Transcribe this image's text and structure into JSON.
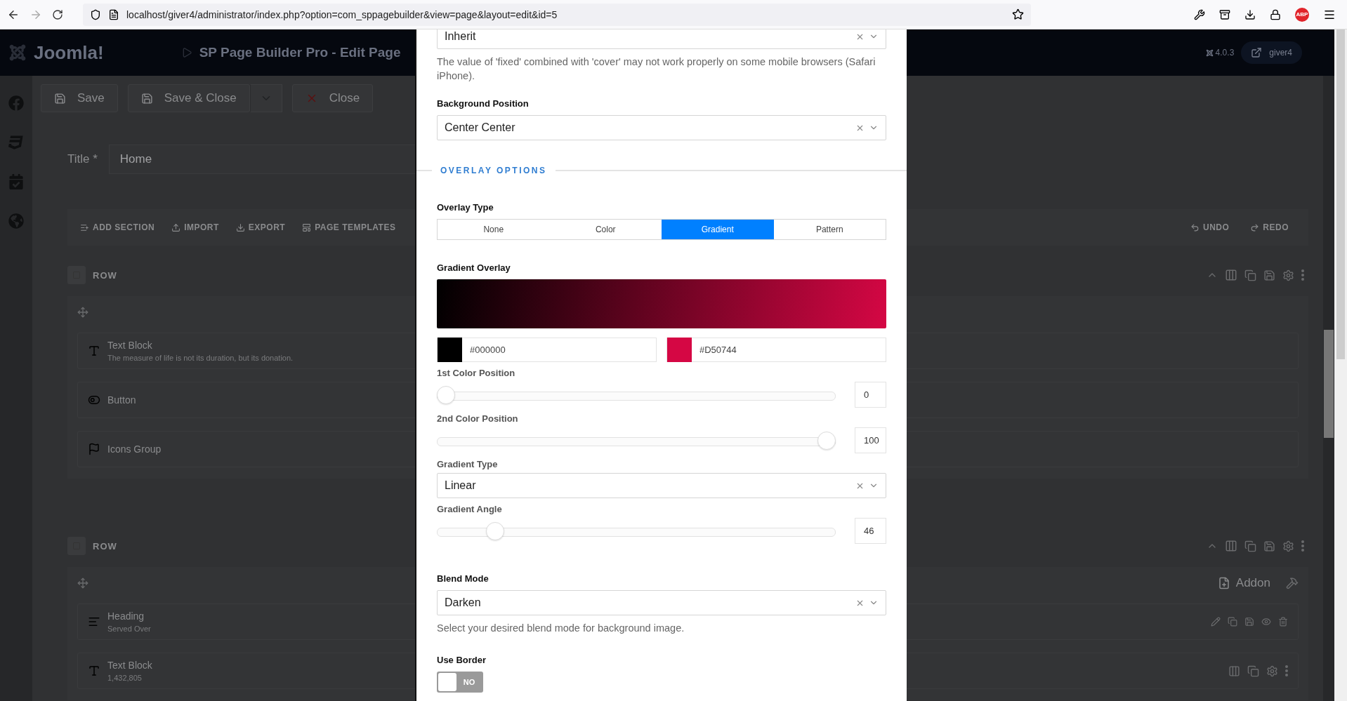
{
  "browser": {
    "url": "localhost/giver4/administrator/index.php?option=com_sppagebuilder&view=page&layout=edit&id=5",
    "extension_badge": "ABP"
  },
  "header": {
    "logo": "Joomla!",
    "title": "SP Page Builder Pro - Edit Page",
    "version": "4.0.3",
    "user": "giver4"
  },
  "toolbar": {
    "buttons": [
      {
        "label": "Save",
        "kind": "save"
      },
      {
        "label": "Save & Close",
        "kind": "save-dropdown"
      },
      {
        "label": "Close",
        "kind": "close"
      }
    ]
  },
  "title_field": {
    "label": "Title *",
    "value": "Home"
  },
  "builder_toolbar": {
    "actions": [
      {
        "label": "ADD SECTION",
        "kind": "add"
      },
      {
        "label": "IMPORT",
        "kind": "import"
      },
      {
        "label": "EXPORT",
        "kind": "export"
      },
      {
        "label": "PAGE TEMPLATES",
        "kind": "templates"
      }
    ],
    "history": [
      {
        "label": "UNDO",
        "kind": "undo"
      },
      {
        "label": "REDO",
        "kind": "redo"
      }
    ]
  },
  "rows": [
    {
      "label": "ROW",
      "items": [
        {
          "kind": "text",
          "title": "Text Block",
          "subtitle": "The measure of life is not its duration, but its donation."
        },
        {
          "kind": "button",
          "title": "Button"
        },
        {
          "kind": "icons",
          "title": "Icons Group"
        }
      ]
    },
    {
      "label": "ROW",
      "addon_label": "Addon",
      "items": [
        {
          "kind": "heading",
          "title": "Heading",
          "subtitle": "Served Over"
        },
        {
          "kind": "text",
          "title": "Text Block",
          "subtitle": "1,432,805"
        }
      ]
    }
  ],
  "modal": {
    "fields": [
      {
        "kind": "select",
        "value": "Inherit",
        "help": "The value of 'fixed' combined with 'cover' may not work properly on some mobile browsers (Safari iPhone)."
      },
      {
        "kind": "select",
        "label": "Background Position",
        "nested": false,
        "value": "Center Center"
      },
      {
        "kind": "section",
        "title": "OVERLAY OPTIONS"
      },
      {
        "kind": "segmented",
        "label": "Overlay Type",
        "options": [
          {
            "label": "None",
            "selected": false
          },
          {
            "label": "Color",
            "selected": false
          },
          {
            "label": "Gradient",
            "selected": true
          },
          {
            "label": "Pattern",
            "selected": false
          }
        ]
      },
      {
        "kind": "gradient",
        "label": "Gradient Overlay",
        "colors": [
          {
            "value": "#000000",
            "color": "#000000"
          },
          {
            "value": "#D50744",
            "color": "#d50744"
          }
        ]
      },
      {
        "kind": "slider",
        "label": "1st Color Position",
        "nested": true,
        "level": 0,
        "value": "0"
      },
      {
        "kind": "slider",
        "label": "2nd Color Position",
        "nested": true,
        "level": 1,
        "value": "100"
      },
      {
        "kind": "select",
        "label": "Gradient Type",
        "nested": true,
        "value": "Linear"
      },
      {
        "kind": "slider",
        "label": "Gradient Angle",
        "nested": true,
        "level": 0.13,
        "value": "46"
      },
      {
        "kind": "select",
        "label": "Blend Mode",
        "nested": false,
        "value": "Darken",
        "help": "Select your desired blend mode for background image."
      },
      {
        "kind": "toggle",
        "label": "Use Border",
        "nested": false,
        "on": false,
        "state_label": "NO"
      }
    ]
  }
}
